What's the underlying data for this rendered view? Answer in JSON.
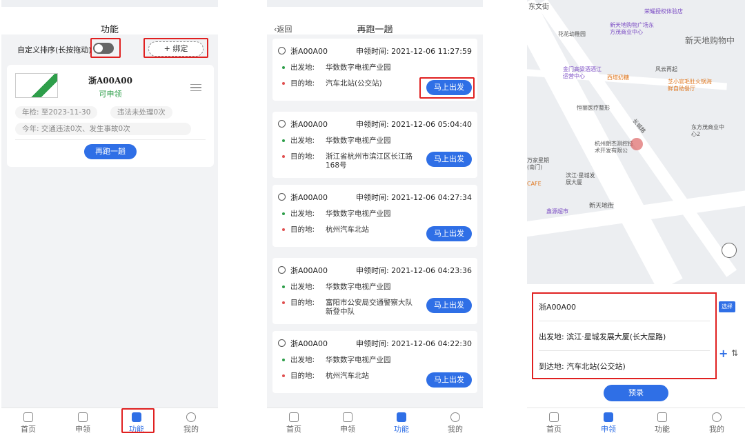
{
  "tabs": [
    "首页",
    "申领",
    "功能",
    "我的"
  ],
  "panel1": {
    "title": "功能",
    "sort_label": "自定义排序(长按拖动)",
    "bind_label": "+ 绑定",
    "vehicle": {
      "plate": "浙A00A00",
      "status": "可申领",
      "badge": "可申领",
      "inspection": "年检: 至2023-11-30",
      "violations": "违法未处理0次",
      "this_year": "今年: 交通违法0次、发生事故0次",
      "run_again": "再跑一趟"
    },
    "active_tab": 2
  },
  "panel2": {
    "back": "返回",
    "title": "再跑一趟",
    "from_label": "出发地:",
    "to_label": "目的地:",
    "go_label": "马上出发",
    "records": [
      {
        "plate": "浙A00A00",
        "time": "申领时间: 2021-12-06 11:27:59",
        "from": "华数数字电视产业园",
        "to": "汽车北站(公交站)"
      },
      {
        "plate": "浙A00A00",
        "time": "申领时间: 2021-12-06 05:04:40",
        "from": "华数数字电视产业园",
        "to": "浙江省杭州市滨江区长江路168号"
      },
      {
        "plate": "浙A00A00",
        "time": "申领时间: 2021-12-06 04:27:34",
        "from": "华数数字电视产业园",
        "to": "杭州汽车北站"
      },
      {
        "plate": "浙A00A00",
        "time": "申领时间: 2021-12-06 04:23:36",
        "from": "华数数字电视产业园",
        "to": "富阳市公安局交通警察大队新登中队"
      },
      {
        "plate": "浙A00A00",
        "time": "申领时间: 2021-12-06 04:22:30",
        "from": "华数数字电视产业园",
        "to": "杭州汽车北站"
      }
    ],
    "active_tab": 2
  },
  "panel3": {
    "map_labels": [
      "东文街",
      "荣耀授权体验店",
      "花花幼稚园",
      "新天地购物广场东方茂商业中心",
      "新天地购物中",
      "金门高粱酒酒江运营中心",
      "西塔奶糖",
      "风云再起",
      "芝小官毛肚火锅海鲜自助餐厅",
      "恒丽医疗整形",
      "东方茂商业中心2",
      "杭州朗杰测控技术开发有限公",
      "万家星期(南门)",
      "滨江·星城发展大厦",
      "CAFE",
      "鑫源超市",
      "新天地街",
      "长城路"
    ],
    "plate": "浙A00A00",
    "select": "选择",
    "from": "出发地:  滨江·星城发展大厦(长大屋路)",
    "to": "到达地:  汽车北站(公交站)",
    "reserve": "预录",
    "active_tab": 1
  },
  "colors": {
    "accent": "#2f6fe6",
    "highlight": "#e02020",
    "ok": "#2e9e4a"
  }
}
